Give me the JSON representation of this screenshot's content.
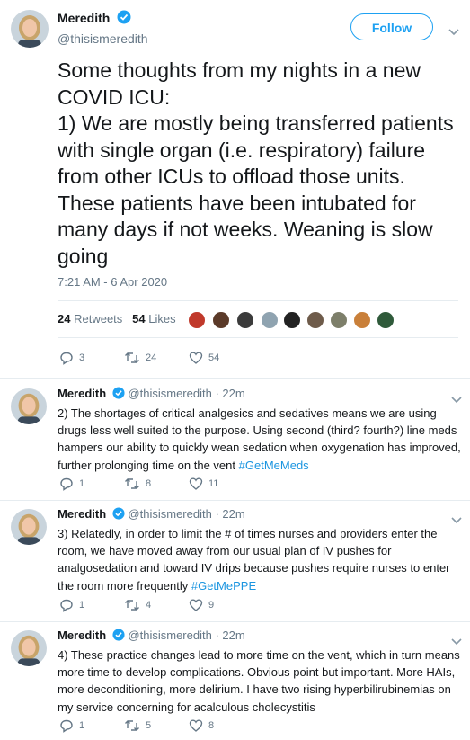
{
  "main_tweet": {
    "author_name": "Meredith",
    "author_handle": "@thisismeredith",
    "follow_label": "Follow",
    "text": "Some thoughts from my nights in a new COVID ICU:\n1) We are mostly being transferred patients with single organ (i.e. respiratory) failure from other ICUs to offload those units. These patients have been intubated for many days if not weeks. Weaning is slow going",
    "timestamp": "7:21 AM - 6 Apr 2020",
    "retweets_count": "24",
    "retweets_label": "Retweets",
    "likes_count": "54",
    "likes_label": "Likes",
    "reply_count": "3",
    "retweet_count": "24",
    "like_count": "54"
  },
  "replies": [
    {
      "author_name": "Meredith",
      "author_handle": "@thisismeredith",
      "time": "· 22m",
      "text": "2) The shortages of critical analgesics and sedatives means we are using drugs less well suited to the purpose. Using second (third? fourth?) line meds hampers our ability to quickly wean sedation when oxygenation has improved, further prolonging time on the vent",
      "hashtag": "#GetMeMeds",
      "reply_count": "1",
      "retweet_count": "8",
      "like_count": "11"
    },
    {
      "author_name": "Meredith",
      "author_handle": "@thisismeredith",
      "time": "· 22m",
      "text": "3) Relatedly, in order to limit the # of times nurses and providers enter the room, we have moved away from our usual plan of IV pushes for analgosedation and toward IV drips because pushes require nurses to enter the room more frequently",
      "hashtag": "#GetMePPE",
      "reply_count": "1",
      "retweet_count": "4",
      "like_count": "9"
    },
    {
      "author_name": "Meredith",
      "author_handle": "@thisismeredith",
      "time": "· 22m",
      "text": "4) These practice changes lead to more time on the vent, which in turn means more time to develop complications. Obvious point but important. More HAIs, more deconditioning, more delirium. I have two rising hyperbilirubinemias on my service concerning for acalculous cholecystitis",
      "hashtag": "",
      "reply_count": "1",
      "retweet_count": "5",
      "like_count": "8"
    }
  ],
  "colors": {
    "accent": "#1da1f2",
    "hashtag": "#1b95e0",
    "muted": "#657786",
    "text": "#14171a",
    "like_icon": "#657786"
  }
}
